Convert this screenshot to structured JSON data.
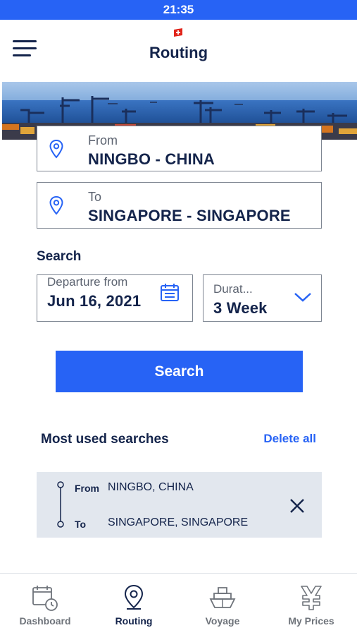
{
  "status_bar": {
    "time": "21:35"
  },
  "header": {
    "title": "Routing"
  },
  "form": {
    "from": {
      "label": "From",
      "value": "NINGBO - CHINA"
    },
    "to": {
      "label": "To",
      "value": "SINGAPORE - SINGAPORE"
    },
    "search_section_label": "Search",
    "departure": {
      "label": "Departure from",
      "value": "Jun 16, 2021"
    },
    "duration": {
      "label": "Durat...",
      "value": "3 Week"
    },
    "search_button": "Search"
  },
  "most_used": {
    "title": "Most used searches",
    "delete_all": "Delete all",
    "items": [
      {
        "from_label": "From",
        "from": "NINGBO, CHINA",
        "to_label": "To",
        "to": "SINGAPORE, SINGAPORE"
      }
    ]
  },
  "tabbar": {
    "tabs": [
      {
        "label": "Dashboard",
        "icon": "calendar-clock-icon",
        "active": false
      },
      {
        "label": "Routing",
        "icon": "location-pin-icon",
        "active": true
      },
      {
        "label": "Voyage",
        "icon": "ship-icon",
        "active": false
      },
      {
        "label": "My Prices",
        "icon": "yen-tag-icon",
        "active": false
      }
    ]
  },
  "colors": {
    "accent": "#2763f5",
    "navy": "#14244b",
    "card_bg": "#e2e7ee",
    "border": "#7d8591"
  }
}
